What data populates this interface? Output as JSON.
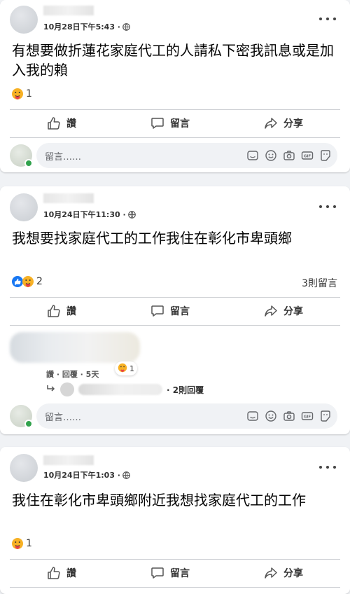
{
  "labels": {
    "like": "讚",
    "comment": "留言",
    "share": "分享",
    "composer_placeholder": "留言……"
  },
  "icons": [
    "globe-icon",
    "more-icon",
    "like-icon",
    "comment-icon",
    "share-icon",
    "sticker-icon",
    "emoji-icon",
    "camera-icon",
    "gif-icon",
    "avatar-sticker-icon",
    "care-reaction-icon",
    "like-reaction-icon",
    "reply-arrow-icon"
  ],
  "colors": {
    "like_blue": "#1877f2",
    "care_yellow": "#f7b125",
    "care_red": "#e9414a",
    "online_green": "#31a24c"
  },
  "posts": [
    {
      "timestamp": "10月28日下午5:43 ·",
      "text": "有想要做折蓮花家庭代工的人請私下密我訊息或是加入我的賴",
      "reaction_count": "1"
    },
    {
      "timestamp": "10月24日下午11:30 ·",
      "text": "我想要找家庭代工的工作我住在彰化市卑頭鄉",
      "reaction_count": "2",
      "comment_count": "3則留言",
      "comment": {
        "meta": "讚 · 回覆 · 5天",
        "reaction_count": "1",
        "replies_label": "· 2則回覆"
      }
    },
    {
      "timestamp": "10月24日下午1:03 ·",
      "text": "我住在彰化市卑頭鄉附近我想找家庭代工的工作",
      "reaction_count": "1"
    }
  ]
}
